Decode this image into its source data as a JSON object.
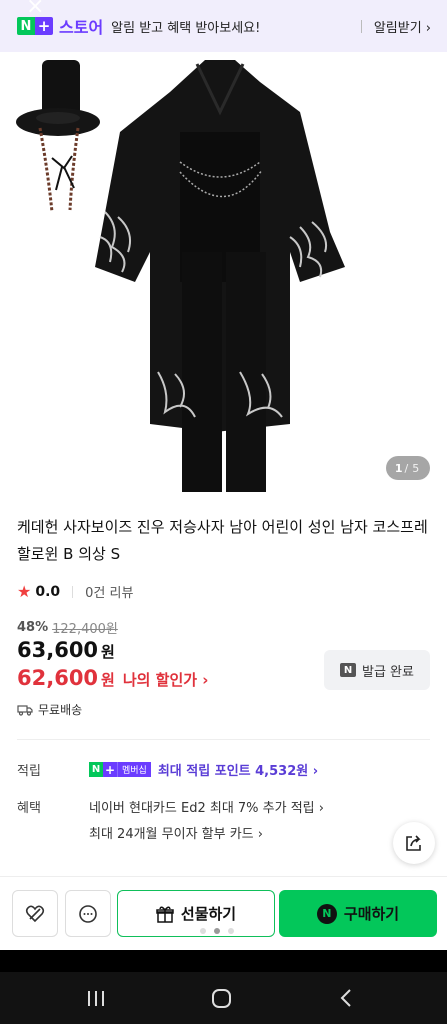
{
  "banner": {
    "close_icon": "×",
    "logo_n": "N",
    "logo_plus": "+",
    "store_label": "스토어",
    "message": "알림 받고 혜택 받아보세요!",
    "action_label": "알림받기 ›"
  },
  "gallery": {
    "current": "1",
    "separator": "/",
    "total": "5"
  },
  "product": {
    "title": "케데헌 사자보이즈 진우 저승사자 남아 어린이 성인 남자 코스프레 할로윈 B 의상 S",
    "rating": "0.0",
    "reviews": "0건 리뷰",
    "discount_pct": "48%",
    "original_price": "122,400원",
    "price": "63,600",
    "price_unit": "원",
    "my_price": "62,600",
    "my_price_unit": "원",
    "my_price_link": "나의 할인가 ›",
    "coupon_button": "발급 완료",
    "shipping": "무료배송"
  },
  "benefits": {
    "points_label": "적립",
    "np_n": "N",
    "np_plus": "+",
    "np_membership": "멤버십",
    "points_text": "최대 적립 포인트 4,532원 ›",
    "benefit_label": "혜택",
    "card_benefit": "네이버 현대카드 Ed2 최대 7% 추가 적립 ›",
    "installment": "최대 24개월 무이자 할부 카드 ›"
  },
  "action_bar": {
    "gift_label": "선물하기",
    "buy_n": "N",
    "buy_label": "구매하기"
  },
  "colors": {
    "naver_green": "#03c75a",
    "membership_purple": "#6b3cff",
    "sale_red": "#e0323c"
  }
}
